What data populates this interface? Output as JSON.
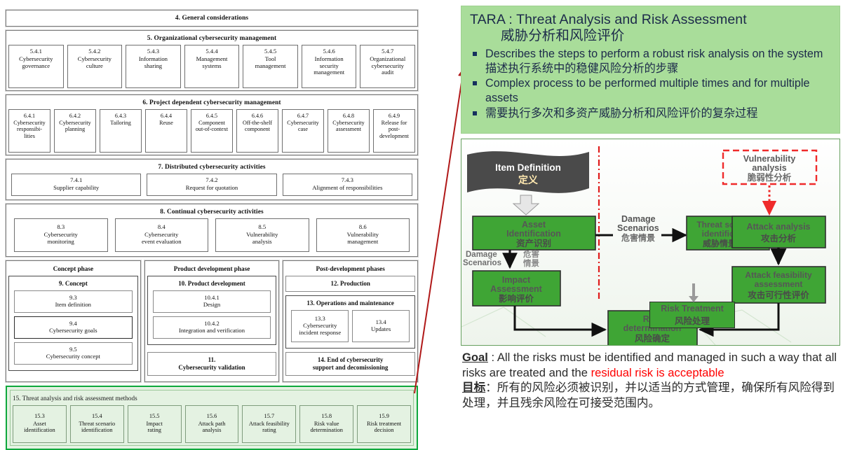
{
  "iso_structure": {
    "band4": {
      "title": "4. General considerations"
    },
    "band5": {
      "title": "5. Organizational cybersecurity management",
      "cells": [
        {
          "num": "5.4.1",
          "label": "Cybersecurity\ngovernance"
        },
        {
          "num": "5.4.2",
          "label": "Cybersecurity\nculture"
        },
        {
          "num": "5.4.3",
          "label": "Information\nsharing"
        },
        {
          "num": "5.4.4",
          "label": "Management\nsystems"
        },
        {
          "num": "5.4.5",
          "label": "Tool\nmanagement"
        },
        {
          "num": "5.4.6",
          "label": "Information\nsecurity\nmanagement"
        },
        {
          "num": "5.4.7",
          "label": "Organizational\ncybersecurity\naudit"
        }
      ]
    },
    "band6": {
      "title": "6. Project dependent cybersecurity management",
      "cells": [
        {
          "num": "6.4.1",
          "label": "Cybersecurity\nresponsibi-\nlities"
        },
        {
          "num": "6.4.2",
          "label": "Cybersecurity\nplanning"
        },
        {
          "num": "6.4.3",
          "label": "Tailoring"
        },
        {
          "num": "6.4.4",
          "label": "Reuse"
        },
        {
          "num": "6.4.5",
          "label": "Component\nout-of-context"
        },
        {
          "num": "6.4.6",
          "label": "Off-the-shelf\ncomponent"
        },
        {
          "num": "6.4.7",
          "label": "Cybersecurity\ncase"
        },
        {
          "num": "6.4.8",
          "label": "Cybersecurity\nassessment"
        },
        {
          "num": "6.4.9",
          "label": "Release for\npost-\ndevelopment"
        }
      ]
    },
    "band7": {
      "title": "7. Distributed cybersecurity activities",
      "cells": [
        {
          "num": "7.4.1",
          "label": "Supplier capability"
        },
        {
          "num": "7.4.2",
          "label": "Request for quotation"
        },
        {
          "num": "7.4.3",
          "label": "Alignment of responsibilities"
        }
      ]
    },
    "band8": {
      "title": "8. Continual cybersecurity activities",
      "cells": [
        {
          "num": "8.3",
          "label": "Cybersecurity\nmonitoring"
        },
        {
          "num": "8.4",
          "label": "Cybersecurity\nevent evaluation"
        },
        {
          "num": "8.5",
          "label": "Vulnerability\nanalysis"
        },
        {
          "num": "8.6",
          "label": "Vulnerability\nmanagement"
        }
      ]
    },
    "phases": [
      {
        "title": "Concept phase",
        "groups": [
          {
            "title": "9. Concept",
            "leaves": [
              {
                "num": "9.3",
                "label": "Item definition",
                "strong": false
              },
              {
                "num": "9.4",
                "label": "Cybersecurity goals",
                "strong": true
              },
              {
                "num": "9.5",
                "label": "Cybersecurity concept",
                "strong": false
              }
            ]
          }
        ],
        "flat": []
      },
      {
        "title": "Product development phase",
        "groups": [
          {
            "title": "10. Product development",
            "leaves": [
              {
                "num": "10.4.1",
                "label": "Design",
                "strong": false
              },
              {
                "num": "10.4.2",
                "label": "Integration and verification",
                "strong": false
              }
            ]
          }
        ],
        "flat": [
          {
            "label": "11.\nCybersecurity validation"
          }
        ]
      },
      {
        "title": "Post-development phases",
        "groups": [
          {
            "title": "13. Operations and maintenance",
            "leaves": [
              {
                "num": "13.3",
                "label": "Cybersecurity\nincident response",
                "strong": false
              },
              {
                "num": "13.4",
                "label": "Updates",
                "strong": false
              }
            ]
          }
        ],
        "flat_top": [
          {
            "label": "12. Production"
          }
        ],
        "flat": [
          {
            "label": "14. End of cybersecurity\nsupport and decomissioning"
          }
        ]
      }
    ],
    "band15": {
      "title": "15. Threat analysis and risk assessment methods",
      "highlight_color": "#0ea83c",
      "fill_color": "#e4f2e2",
      "cells": [
        {
          "num": "15.3",
          "label": "Asset\nidentification"
        },
        {
          "num": "15.4",
          "label": "Threat scenario\nidentification"
        },
        {
          "num": "15.5",
          "label": "Impact\nrating"
        },
        {
          "num": "15.6",
          "label": "Attack path\nanalysis"
        },
        {
          "num": "15.7",
          "label": "Attack feasibility\nrating"
        },
        {
          "num": "15.8",
          "label": "Risk value\ndetermination"
        },
        {
          "num": "15.9",
          "label": "Risk treatment\ndecision"
        }
      ]
    }
  },
  "connector": {
    "color": "#b01818"
  },
  "tara": {
    "background_color": "#a9dd9a",
    "text_color": "#1c2a4a",
    "title_en": "TARA : Threat Analysis and Risk Assessment",
    "title_cn": "威胁分析和风险评价",
    "bullets": [
      "Describes the steps to perform a robust risk analysis on the system 描述执行系统中的稳健风险分析的步骤",
      "Complex process to be performed multiple times and for multiple assets",
      "需要执行多次和多资产威胁分析和风险评价的复杂过程"
    ]
  },
  "flow": {
    "border_color": "#66a05f",
    "box_fill": "#3fa535",
    "box_text_color": "#4c4c4c",
    "banner_fill": "#4a4a4a",
    "banner_text_color": "#ffffff",
    "divider_color": "#e01b1b",
    "vuln_border_color": "#ef2b2b",
    "nodes": [
      {
        "id": "item-definition",
        "en": "Item Definition",
        "cn": "定义",
        "type": "banner"
      },
      {
        "id": "asset-identification",
        "en": "Asset\nIdentification",
        "cn": "资产识别",
        "type": "process"
      },
      {
        "id": "impact-assessment",
        "en": "Impact\nAssessment",
        "cn": "影响评价",
        "type": "process"
      },
      {
        "id": "threat-scenario-identification",
        "en": "Threat scenario\nidentification",
        "cn": "威胁情景识别",
        "type": "process"
      },
      {
        "id": "attack-analysis",
        "en": "Attack analysis",
        "cn": "攻击分析",
        "type": "process"
      },
      {
        "id": "attack-feasibility-assessment",
        "en": "Attack feasibility\nassessment",
        "cn": "攻击可行性评价",
        "type": "process"
      },
      {
        "id": "risk-determination",
        "en": "Risk\ndetermination",
        "cn": "风险确定",
        "type": "process"
      },
      {
        "id": "risk-treatment",
        "en": "Risk Treatment",
        "cn": "风险处理",
        "type": "process"
      },
      {
        "id": "vulnerability-analysis",
        "en": "Vulnerability\nanalysis",
        "cn": "脆弱性分析",
        "type": "dashed"
      }
    ],
    "edge_labels": [
      {
        "id": "damage-scenarios-right",
        "en": "Damage\nScenarios",
        "cn": "危害情景"
      },
      {
        "id": "damage-scenarios-down",
        "en": "Damage\nScenarios",
        "cn": "危害\n情景"
      }
    ]
  },
  "goal": {
    "label": "Goal",
    "colon": " : ",
    "text_en_1": "All the risks must be identified and managed in such a way that all risks are treated and the ",
    "text_en_red": "residual risk is acceptable",
    "label_cn": "目标",
    "text_cn": "：所有的风险必须被识别，并以适当的方式管理，确保所有风险得到处理，并且残余风险在可接受范围内。",
    "red_color": "#ff0000"
  }
}
